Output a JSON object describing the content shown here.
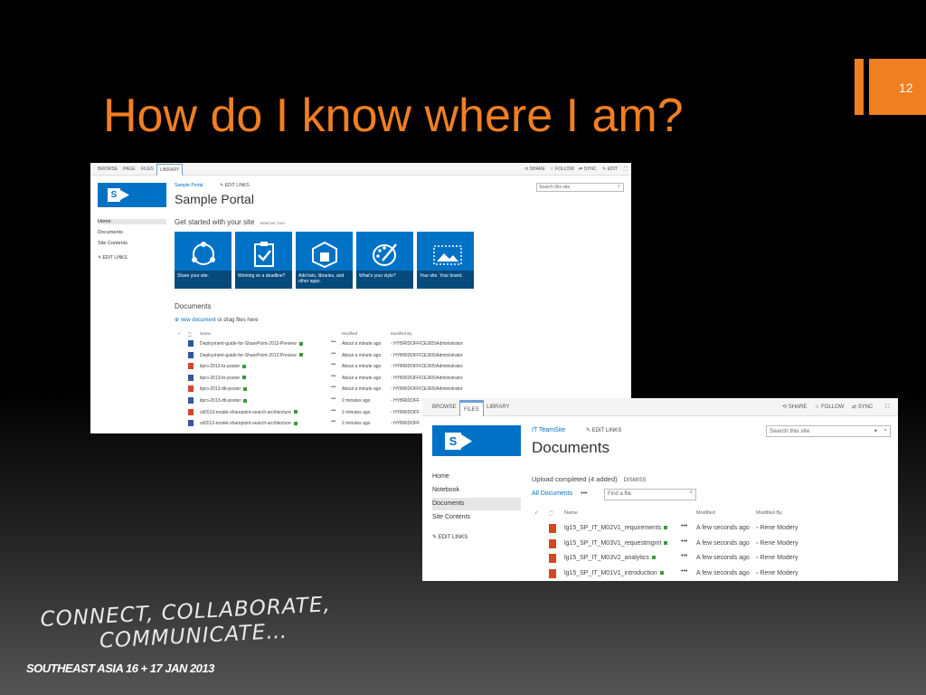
{
  "slide": {
    "title": "How do I know where I am?",
    "number": "12",
    "tagline_line1": "CONNECT, COLLABORATE,",
    "tagline_line2": "COMMUNICATE…",
    "event": "SOUTHEAST ASIA 16 + 17 JAN 2013",
    "accent_color": "#f07f21"
  },
  "screenshot1": {
    "ribbon_tabs": [
      "BROWSE",
      "PAGE",
      "FILES",
      "LIBRARY"
    ],
    "ribbon_actions": [
      "SHARE",
      "FOLLOW",
      "SYNC",
      "EDIT"
    ],
    "logo_letter": "S",
    "breadcrumb": "Sample Portal",
    "edit_links_top": "EDIT LINKS",
    "site_title": "Sample Portal",
    "search_placeholder": "Search this site",
    "nav": [
      "Home",
      "Documents",
      "Site Contents"
    ],
    "nav_edit_links": "EDIT LINKS",
    "get_started": "Get started with your site",
    "remove_this": "REMOVE THIS",
    "tiles": [
      {
        "caption": "Share your site.",
        "icon": "share-icon"
      },
      {
        "caption": "Working on a deadline?",
        "icon": "checklist-icon"
      },
      {
        "caption": "Add lists, libraries, and other apps.",
        "icon": "add-app-icon"
      },
      {
        "caption": "What's your style?",
        "icon": "palette-icon"
      },
      {
        "caption": "Your site. Your brand.",
        "icon": "image-icon"
      }
    ],
    "documents_heading": "Documents",
    "new_document": "new document",
    "drag_files": " or drag files here",
    "columns": {
      "name": "Name",
      "modified": "Modified",
      "modified_by": "Modified By"
    },
    "rows": [
      {
        "name": "Deployment-guide-for-SharePoint-2013-Preview",
        "modified": "About a minute ago",
        "by": "HYBRIDOFFICE365\\Administrator",
        "type": "word"
      },
      {
        "name": "Deployment-guide-for-SharePoint-2013-Preview",
        "modified": "About a minute ago",
        "by": "HYBRIDOFFICE365\\Administrator",
        "type": "word"
      },
      {
        "name": "itpro-2013-br-poster",
        "modified": "About a minute ago",
        "by": "HYBRIDOFFICE365\\Administrator",
        "type": "pdf"
      },
      {
        "name": "itpro-2013-br-poster",
        "modified": "About a minute ago",
        "by": "HYBRIDOFFICE365\\Administrator",
        "type": "visio"
      },
      {
        "name": "itpro-2013-db-poster",
        "modified": "About a minute ago",
        "by": "HYBRIDOFFICE365\\Administrator",
        "type": "pdf"
      },
      {
        "name": "itpro-2013-db-poster",
        "modified": "2 minutes ago",
        "by": "HYBRIDOFF",
        "type": "visio"
      },
      {
        "name": "oil2013-model-sharepoint-search-architecture",
        "modified": "2 minutes ago",
        "by": "HYBRIDOFF",
        "type": "pdf"
      },
      {
        "name": "oil2013-model-sharepoint-search-architecture",
        "modified": "2 minutes ago",
        "by": "HYBRIDOFF",
        "type": "visio"
      }
    ]
  },
  "screenshot2": {
    "ribbon_tabs": [
      "BROWSE",
      "FILES",
      "LIBRARY"
    ],
    "ribbon_actions": [
      "SHARE",
      "FOLLOW",
      "SYNC"
    ],
    "logo_letter": "S",
    "breadcrumb": "IT TeamSite",
    "edit_links_top": "EDIT LINKS",
    "page_title": "Documents",
    "search_placeholder": "Search this site",
    "nav": [
      "Home",
      "Notebook",
      "Documents",
      "Site Contents"
    ],
    "nav_edit_links": "EDIT LINKS",
    "upload_status": "Upload completed (4 added)",
    "dismiss": "DISMISS",
    "all_documents": "All Documents",
    "view_more": "•••",
    "find_placeholder": "Find a file",
    "columns": {
      "name": "Name",
      "modified": "Modified",
      "modified_by": "Modified By"
    },
    "rows": [
      {
        "name": "lg15_SP_IT_M02V1_requirements",
        "modified": "A few seconds ago",
        "by": "Rene Modery"
      },
      {
        "name": "lg15_SP_IT_M03V1_requestmgmt",
        "modified": "A few seconds ago",
        "by": "Rene Modery"
      },
      {
        "name": "lg15_SP_IT_M03V2_analytics",
        "modified": "A few seconds ago",
        "by": "Rene Modery"
      },
      {
        "name": "lg15_SP_IT_M01V1_introduction",
        "modified": "A few seconds ago",
        "by": "Rene Modery"
      }
    ]
  }
}
